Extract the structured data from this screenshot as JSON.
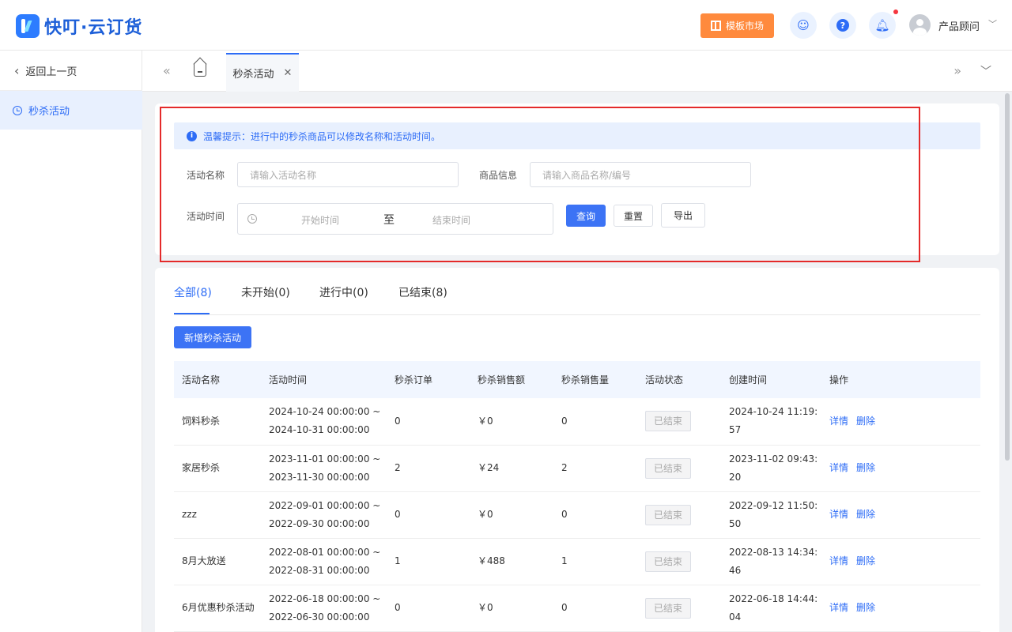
{
  "header": {
    "logo_text": "快叮·云订货",
    "template_market_label": "模板市场",
    "user_name": "产品顾问",
    "icons": [
      "customer-service-icon",
      "help-icon",
      "bell-icon",
      "avatar",
      "chevron-down-icon"
    ]
  },
  "sidebar": {
    "back_label": "返回上一页",
    "items": [
      {
        "label": "秒杀活动",
        "icon": "clock-icon",
        "active": true
      }
    ]
  },
  "tabbar": {
    "active_tab": "秒杀活动"
  },
  "filter": {
    "notice": "温馨提示：进行中的秒杀商品可以修改名称和活动时间。",
    "name_label": "活动名称",
    "name_placeholder": "请输入活动名称",
    "product_label": "商品信息",
    "product_placeholder": "请输入商品名称/编号",
    "time_label": "活动时间",
    "start_placeholder": "开始时间",
    "range_separator": "至",
    "end_placeholder": "结束时间",
    "query_label": "查询",
    "reset_label": "重置",
    "export_label": "导出"
  },
  "list": {
    "tabs": [
      {
        "label": "全部(8)",
        "active": true
      },
      {
        "label": "未开始(0)",
        "active": false
      },
      {
        "label": "进行中(0)",
        "active": false
      },
      {
        "label": "已结束(8)",
        "active": false
      }
    ],
    "add_label": "新增秒杀活动",
    "columns": [
      "活动名称",
      "活动时间",
      "秒杀订单",
      "秒杀销售额",
      "秒杀销售量",
      "活动状态",
      "创建时间",
      "操作"
    ],
    "rows": [
      {
        "name": "饲料秒杀",
        "time": "2024-10-24 00:00:00 ~ 2024-10-31 00:00:00",
        "orders": "0",
        "amount": "￥0",
        "qty": "0",
        "status": "已结束",
        "created": "2024-10-24 11:19:57",
        "detail": "详情",
        "delete": "删除"
      },
      {
        "name": "家居秒杀",
        "time": "2023-11-01 00:00:00 ~ 2023-11-30 00:00:00",
        "orders": "2",
        "amount": "￥24",
        "qty": "2",
        "status": "已结束",
        "created": "2023-11-02 09:43:20",
        "detail": "详情",
        "delete": "删除"
      },
      {
        "name": "zzz",
        "time": "2022-09-01 00:00:00 ~ 2022-09-30 00:00:00",
        "orders": "0",
        "amount": "￥0",
        "qty": "0",
        "status": "已结束",
        "created": "2022-09-12 11:50:50",
        "detail": "详情",
        "delete": "删除"
      },
      {
        "name": "8月大放送",
        "time": "2022-08-01 00:00:00 ~ 2022-08-31 00:00:00",
        "orders": "1",
        "amount": "￥488",
        "qty": "1",
        "status": "已结束",
        "created": "2022-08-13 14:34:46",
        "detail": "详情",
        "delete": "删除"
      },
      {
        "name": "6月优惠秒杀活动",
        "time": "2022-06-18 00:00:00 ~ 2022-06-30 00:00:00",
        "orders": "0",
        "amount": "￥0",
        "qty": "0",
        "status": "已结束",
        "created": "2022-06-18 14:44:04",
        "detail": "详情",
        "delete": "删除"
      }
    ]
  },
  "colors": {
    "primary": "#2d6cf6",
    "template_button": "#ff8a3d",
    "highlight_frame": "#e42a2a"
  }
}
